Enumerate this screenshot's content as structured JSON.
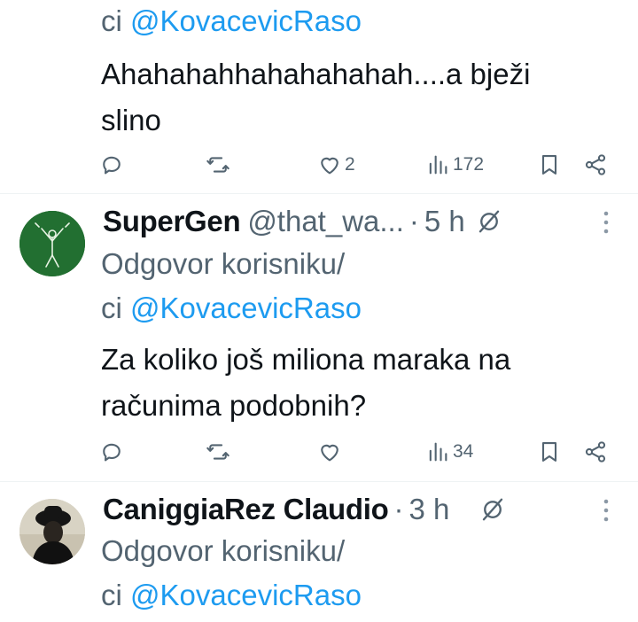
{
  "tweets": [
    {
      "reply_prefix": "ci ",
      "reply_mention": "@KovacevicRaso",
      "text_lines": [
        "Ahahahahhahahahahah....a bježi",
        "slino"
      ],
      "reply_count": "",
      "retweet_count": "",
      "like_count": "2",
      "view_count": "172"
    },
    {
      "name": "SuperGen",
      "handle": "@that_wa...",
      "separator": "·",
      "time": "5 h",
      "reply_label": "Odgovor korisniku/",
      "reply_prefix": "ci ",
      "reply_mention": "@KovacevicRaso",
      "text_lines": [
        "Za koliko još miliona maraka na",
        "računima podobnih?"
      ],
      "reply_count": "",
      "retweet_count": "",
      "like_count": "",
      "view_count": "34"
    },
    {
      "name": "CaniggiaRez Claudio",
      "separator": "·",
      "time": "3 h",
      "reply_label": "Odgovor korisniku/",
      "reply_prefix": "ci ",
      "reply_mention": "@KovacevicRaso"
    }
  ],
  "colors": {
    "text": "#0f1419",
    "secondary": "#536471",
    "mention": "#1d9bf0",
    "divider": "#eff3f4",
    "avatar_green": "#1f6b2e"
  },
  "icons": [
    "reply-icon",
    "retweet-icon",
    "like-icon",
    "views-icon",
    "bookmark-icon",
    "share-icon",
    "grok-icon",
    "more-icon"
  ]
}
